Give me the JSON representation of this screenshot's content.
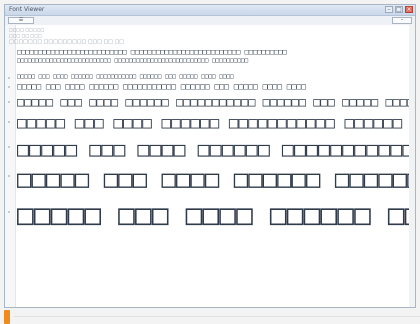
{
  "window": {
    "title": "Font Viewer"
  },
  "toolbar": {
    "button1": "☰",
    "button2": "–"
  },
  "info_lines": [
    "□□□□ □□□□□",
    "□□□ □□ □□□",
    "□□□□□□□ □□□□□□□□□ □□□ □□ □□"
  ],
  "sample_text": "□□□□□ □□□ □□□□ □□□□□□ □□□□□□□□□□□ □□□□□□ □□□ □□□□□ □□□□ □□□□",
  "alphabet_line": "□□□□□□□□□□□□□□□□□□□□□□□□□□ □□□□□□□□□□□□□□□□□□□□□□□□□□ □□□□□□□□□□",
  "colors": {
    "accent": "#f08a1c",
    "glyph": "#2f3a4a",
    "frame": "#a9b6c6"
  }
}
